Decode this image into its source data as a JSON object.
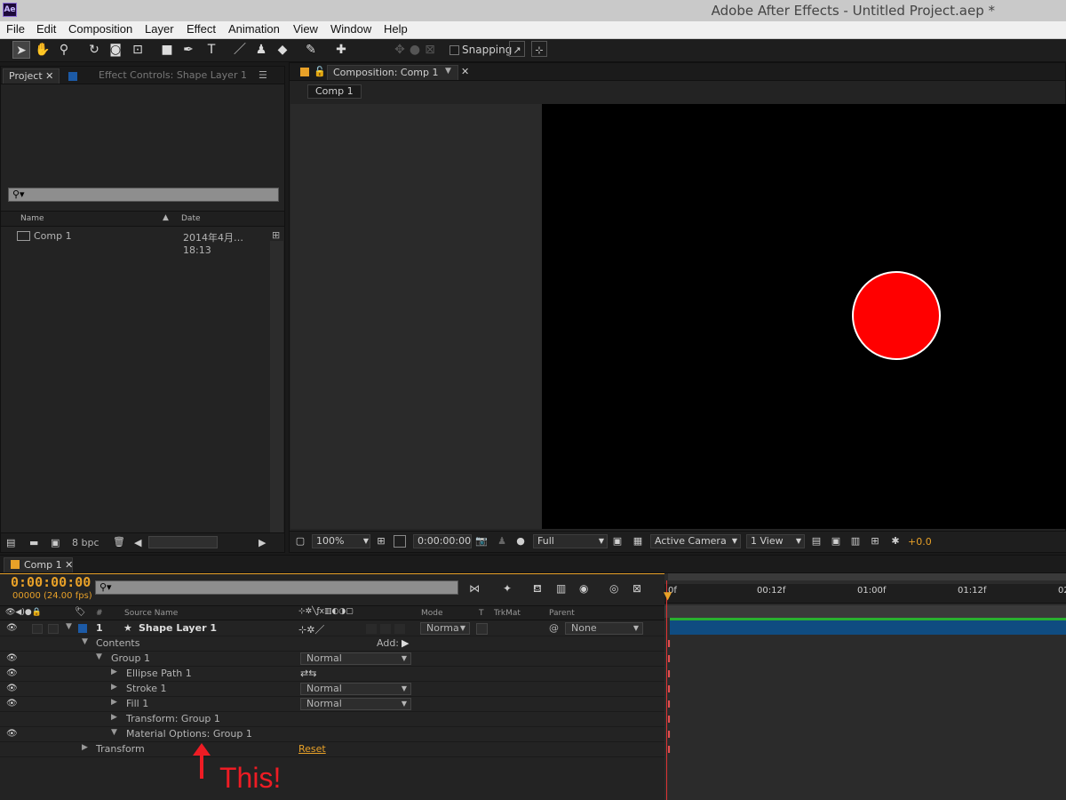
{
  "app": {
    "logo": "Ae",
    "window_title": "Adobe After Effects - Untitled Project.aep *"
  },
  "menu": [
    "File",
    "Edit",
    "Composition",
    "Layer",
    "Effect",
    "Animation",
    "View",
    "Window",
    "Help"
  ],
  "toolbar": {
    "snapping_label": "Snapping"
  },
  "project_panel": {
    "tabs": [
      "Project",
      "Effect Controls: Shape Layer 1"
    ],
    "columns": {
      "name": "Name",
      "date": "Date"
    },
    "items": [
      {
        "name": "Comp 1",
        "date": "2014年4月… 18:13"
      }
    ],
    "bpc": "8 bpc"
  },
  "composition_panel": {
    "tab": "Composition: Comp 1",
    "breadcrumb": "Comp 1",
    "zoom": "100%",
    "timecode": "0:00:00:00",
    "resolution": "Full",
    "camera": "Active Camera",
    "views": "1 View",
    "exposure": "+0.0",
    "colors": {
      "circle_fill": "#ff0000",
      "circle_stroke": "#ffffff"
    }
  },
  "timeline": {
    "tab": "Comp 1",
    "timecode": "0:00:00:00",
    "fps": "00000 (24.00 fps)",
    "columns": {
      "num": "#",
      "source": "Source Name",
      "mode": "Mode",
      "t": "T",
      "trkmat": "TrkMat",
      "parent": "Parent"
    },
    "layer": {
      "num": "1",
      "name": "Shape Layer 1",
      "mode": "Norma",
      "parent": "None"
    },
    "contents": "Contents",
    "add": "Add:",
    "group": "Group 1",
    "group_mode": "Normal",
    "ellipse": "Ellipse Path 1",
    "stroke": "Stroke 1",
    "stroke_mode": "Normal",
    "fill": "Fill 1",
    "fill_mode": "Normal",
    "transform_group": "Transform: Group 1",
    "material": "Material Options: Group 1",
    "transform": "Transform",
    "reset": "Reset",
    "ruler": [
      "0f",
      "00:12f",
      "01:00f",
      "01:12f",
      "02"
    ]
  },
  "annotation": {
    "text": "This!",
    "color": "#ee1c24"
  }
}
